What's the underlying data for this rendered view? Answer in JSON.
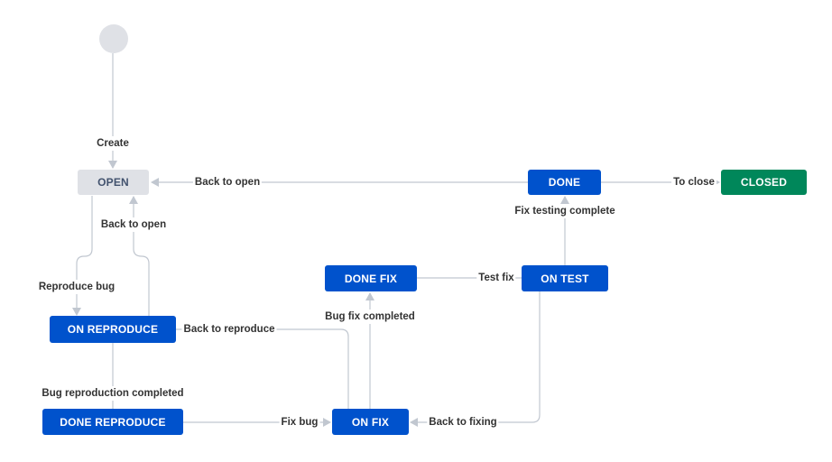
{
  "diagram": {
    "statuses": {
      "open": "OPEN",
      "done": "DONE",
      "closed": "CLOSED",
      "on_reproduce": "ON REPRODUCE",
      "done_fix": "DONE FIX",
      "on_test": "ON TEST",
      "done_reproduce": "DONE REPRODUCE",
      "on_fix": "ON FIX"
    },
    "transitions": {
      "create": "Create",
      "back_to_open_from_done": "Back to open",
      "to_close": "To close",
      "back_to_open_from_reproduce": "Back to open",
      "fix_testing_complete": "Fix testing complete",
      "reproduce_bug": "Reproduce bug",
      "test_fix": "Test fix",
      "bug_fix_completed": "Bug fix completed",
      "back_to_reproduce": "Back to reproduce",
      "bug_reproduction_completed": "Bug reproduction completed",
      "fix_bug": "Fix bug",
      "back_to_fixing": "Back to fixing"
    },
    "colors": {
      "in_progress": "#0052cc",
      "todo": "#dfe1e6",
      "todo_text": "#42526e",
      "done": "#00875a",
      "connector": "#c1c7d0"
    }
  }
}
